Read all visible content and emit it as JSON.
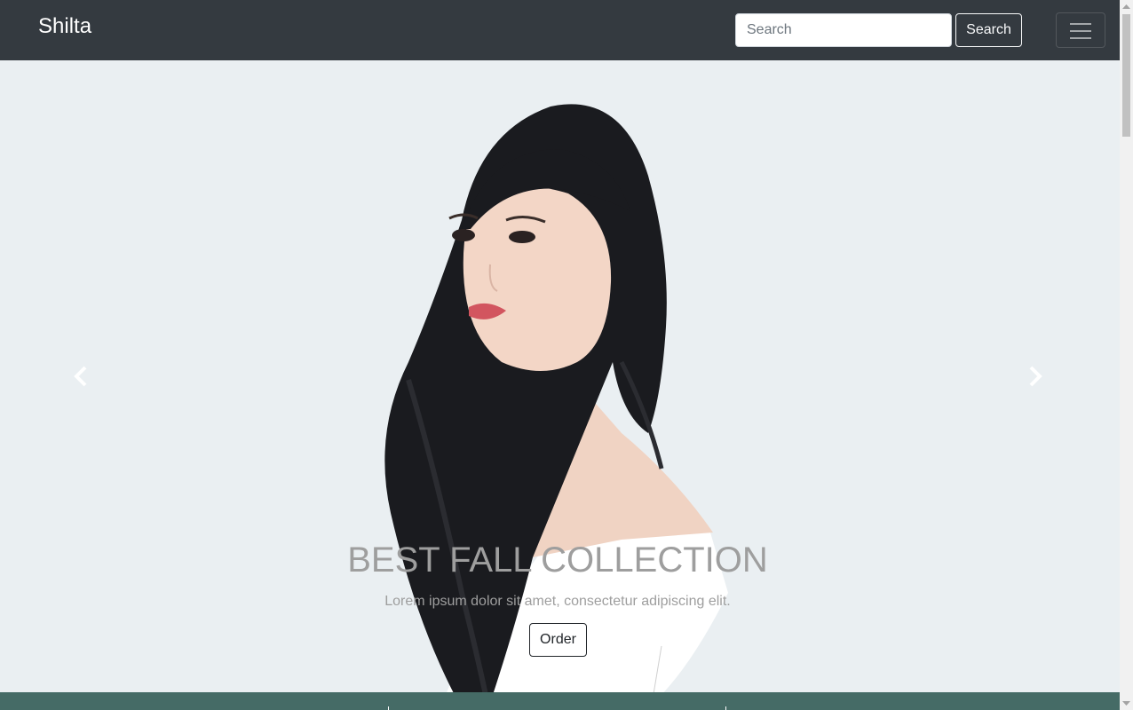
{
  "navbar": {
    "brand": "Shilta",
    "search": {
      "placeholder": "Search",
      "value": ""
    },
    "search_button_label": "Search",
    "toggler_icon": "hamburger-menu-icon"
  },
  "carousel": {
    "slide": {
      "image": "portrait-woman-photo",
      "title": "BEST FALL COLLECTION",
      "text": "Lorem ipsum dolor sit amet, consectetur adipiscing elit.",
      "button_label": "Order"
    },
    "prev_icon": "chevron-left-icon",
    "next_icon": "chevron-right-icon",
    "indicators": [
      {
        "active": true
      },
      {
        "active": false
      }
    ]
  },
  "colors": {
    "navbar_bg": "#343a40",
    "page_bg": "#eaeff2",
    "band_bg": "#456b66",
    "caption_text": "#9e9e9e"
  }
}
